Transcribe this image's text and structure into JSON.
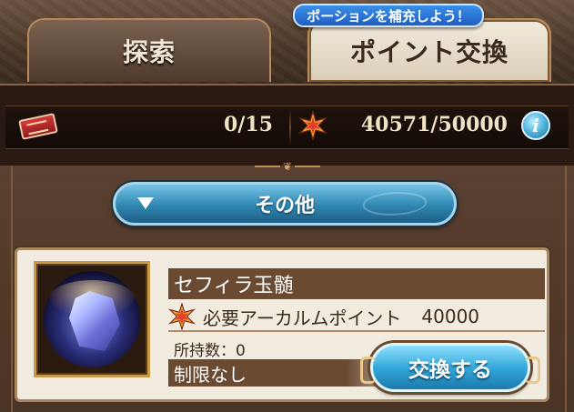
{
  "tabs": {
    "banner": "ポーションを補充しよう！",
    "explore_label": "探索",
    "exchange_label": "ポイント交換"
  },
  "status": {
    "ticket_icon": "red-ticket-icon",
    "ticket_count": "0/15",
    "point_icon": "arcarum-star-icon",
    "points": "40571/50000",
    "info_icon": "info-icon",
    "info_label": "i"
  },
  "filter": {
    "selected": "その他"
  },
  "item": {
    "name": "セフィラ玉髄",
    "icon": "sephira-stone-icon",
    "cost_label": "必要アーカルムポイント",
    "cost_value": "40000",
    "owned": "所持数：0",
    "limit": "制限なし",
    "exchange_label": "交換する"
  },
  "colors": {
    "accent_blue": "#35a9da",
    "panel_brown": "#6b4a32",
    "card_bg": "#f2ece0",
    "banner_blue": "#1f5fc2"
  }
}
